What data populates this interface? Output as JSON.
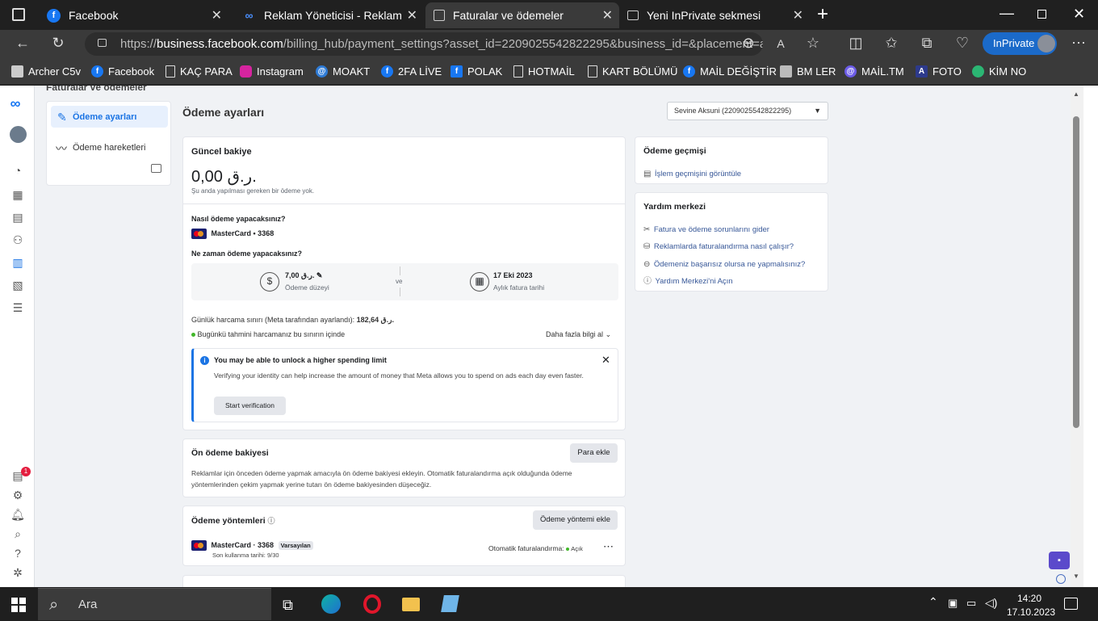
{
  "browser": {
    "tabs": [
      {
        "title": "Facebook"
      },
      {
        "title": "Reklam Yöneticisi - Reklamları Yö"
      },
      {
        "title": "Faturalar ve ödemeler"
      },
      {
        "title": "Yeni InPrivate sekmesi"
      }
    ],
    "url_prefix": "https://",
    "url_domain": "business.facebook.com",
    "url_rest": "/billing_hub/payment_settings?asset_id=2209025542822295&business_id=&placement=a...",
    "inprivate_label": "InPrivate",
    "bookmarks": [
      "Archer C5v",
      "Facebook",
      "KAÇ PARA",
      "Instagram",
      "MOAKT",
      "2FA LİVE",
      "POLAK",
      "HOTMAİL",
      "KART BÖLÜMÜ",
      "MAİL DEĞİŞTİR",
      "BM LER",
      "MAİL.TM",
      "FOTO",
      "KİM NO"
    ]
  },
  "page": {
    "header_partial": "Faturalar ve ödemeler",
    "nav": {
      "payment_settings": "Ödeme ayarları",
      "payment_activity": "Ödeme hareketleri"
    },
    "title": "Ödeme ayarları",
    "account_select": "Sevine Aksuni (2209025542822295)",
    "balance": {
      "title": "Güncel bakiye",
      "amount": "0,00 ر.ق.",
      "note": "Şu anda yapılması gereken bir ödeme yok."
    },
    "how_pay": {
      "question": "Nasıl ödeme yapacaksınız?",
      "card": "MasterCard • 3368"
    },
    "when_pay": {
      "question": "Ne zaman ödeme yapacaksınız?",
      "threshold_value": "7,00 ر.ق.",
      "threshold_label": "Ödeme düzeyi",
      "separator": "ve",
      "date_value": "17 Eki 2023",
      "date_label": "Aylık fatura tarihi"
    },
    "daily_limit": {
      "text": "Günlük harcama sınırı (Meta tarafından ayarlandı):",
      "value": "182,64 ر.ق.",
      "status": "Bugünkü tahmini harcamanız bu sınırın içinde",
      "more": "Daha fazla bilgi al"
    },
    "notice": {
      "title": "You may be able to unlock a higher spending limit",
      "body": "Verifying your identity can help increase the amount of money that Meta allows you to spend on ads each day even faster.",
      "button": "Start verification"
    },
    "prepaid": {
      "title": "Ön ödeme bakiyesi",
      "button": "Para ekle",
      "body": "Reklamlar için önceden ödeme yapmak amacıyla ön ödeme bakiyesi ekleyin. Otomatik faturalandırma açık olduğunda ödeme yöntemlerinden çekim yapmak yerine tutarı ön ödeme bakiyesinden düşeceğiz."
    },
    "methods": {
      "title": "Ödeme yöntemleri",
      "button": "Ödeme yöntemi ekle",
      "card": "MasterCard · 3368",
      "default_badge": "Varsayılan",
      "expiry": "Son kullanma tarihi: 9/30",
      "auto_billing": "Otomatik faturalandırma:",
      "auto_state": "Açık"
    },
    "history": {
      "title": "Ödeme geçmişi",
      "link": "İşlem geçmişini görüntüle"
    },
    "help": {
      "title": "Yardım merkezi",
      "links": [
        "Fatura ve ödeme sorunlarını gider",
        "Reklamlarda faturalandırma nasıl çalışır?",
        "Ödemeniz başarısız olursa ne yapmalısınız?",
        "Yardım Merkezi'ni Açın"
      ]
    },
    "notification_count": "1"
  },
  "taskbar": {
    "search_placeholder": "Ara",
    "time": "14:20",
    "date": "17.10.2023"
  },
  "colors": {
    "accent": "#1b74e4",
    "inprivate": "#1b6ac9",
    "status_green": "#42b72a"
  }
}
